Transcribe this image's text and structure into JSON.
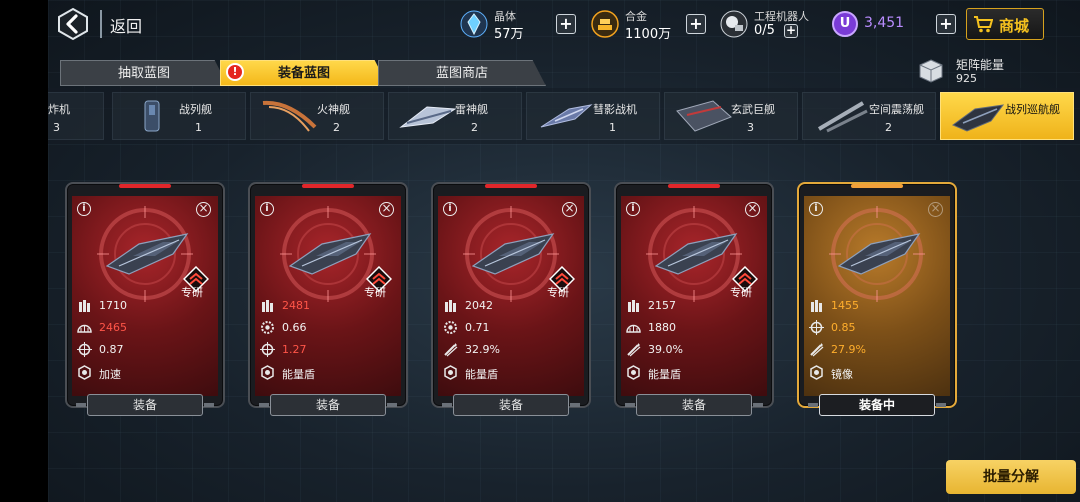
{
  "header": {
    "back_label": "返回",
    "crystal": {
      "name": "晶体",
      "value": "57万"
    },
    "alloy": {
      "name": "合金",
      "value": "1100万"
    },
    "robot": {
      "name": "工程机器人",
      "value": "0/5"
    },
    "premium": {
      "value": "3,451"
    },
    "shop_label": "商城",
    "plus_label": "+"
  },
  "tabs": [
    {
      "label": "抽取蓝图",
      "active": false
    },
    {
      "label": "装备蓝图",
      "active": true,
      "alert": "!"
    },
    {
      "label": "蓝图商店",
      "active": false
    }
  ],
  "matrix": {
    "name": "矩阵能量",
    "value": "925"
  },
  "ships": [
    {
      "name": "轰炸机",
      "count": "3"
    },
    {
      "name": "战列舰",
      "count": "1"
    },
    {
      "name": "火神舰",
      "count": "2"
    },
    {
      "name": "雷神舰",
      "count": "2"
    },
    {
      "name": "彗影战机",
      "count": "1"
    },
    {
      "name": "玄武巨舰",
      "count": "3"
    },
    {
      "name": "空间震荡舰",
      "count": "2"
    },
    {
      "name": "战列巡航舰",
      "count": "",
      "active": true
    }
  ],
  "cards": [
    {
      "rank_label": "专研",
      "stats": [
        "1710",
        "2465",
        "0.87",
        "加速"
      ],
      "equip": "装备",
      "equipped": false
    },
    {
      "rank_label": "专研",
      "stats": [
        "2481",
        "0.66",
        "1.27",
        "能量盾"
      ],
      "equip": "装备",
      "equipped": false
    },
    {
      "rank_label": "专研",
      "stats": [
        "2042",
        "0.71",
        "32.9%",
        "能量盾"
      ],
      "equip": "装备",
      "equipped": false
    },
    {
      "rank_label": "专研",
      "stats": [
        "2157",
        "1880",
        "39.0%",
        "能量盾"
      ],
      "equip": "装备",
      "equipped": false
    },
    {
      "rank_label": "",
      "stats": [
        "1455",
        "0.85",
        "27.9%",
        "镜像"
      ],
      "equip": "装备中",
      "equipped": true
    }
  ],
  "icon_labels": {
    "info": "i",
    "close": "×"
  },
  "batch_label": "批量分解",
  "colors": {
    "accent_gold": "#f4b81a",
    "card_red": "#a8252a",
    "stat_red": "#ff5548",
    "stat_orange": "#ffae2c",
    "premium_purple": "#7a3bd6"
  }
}
